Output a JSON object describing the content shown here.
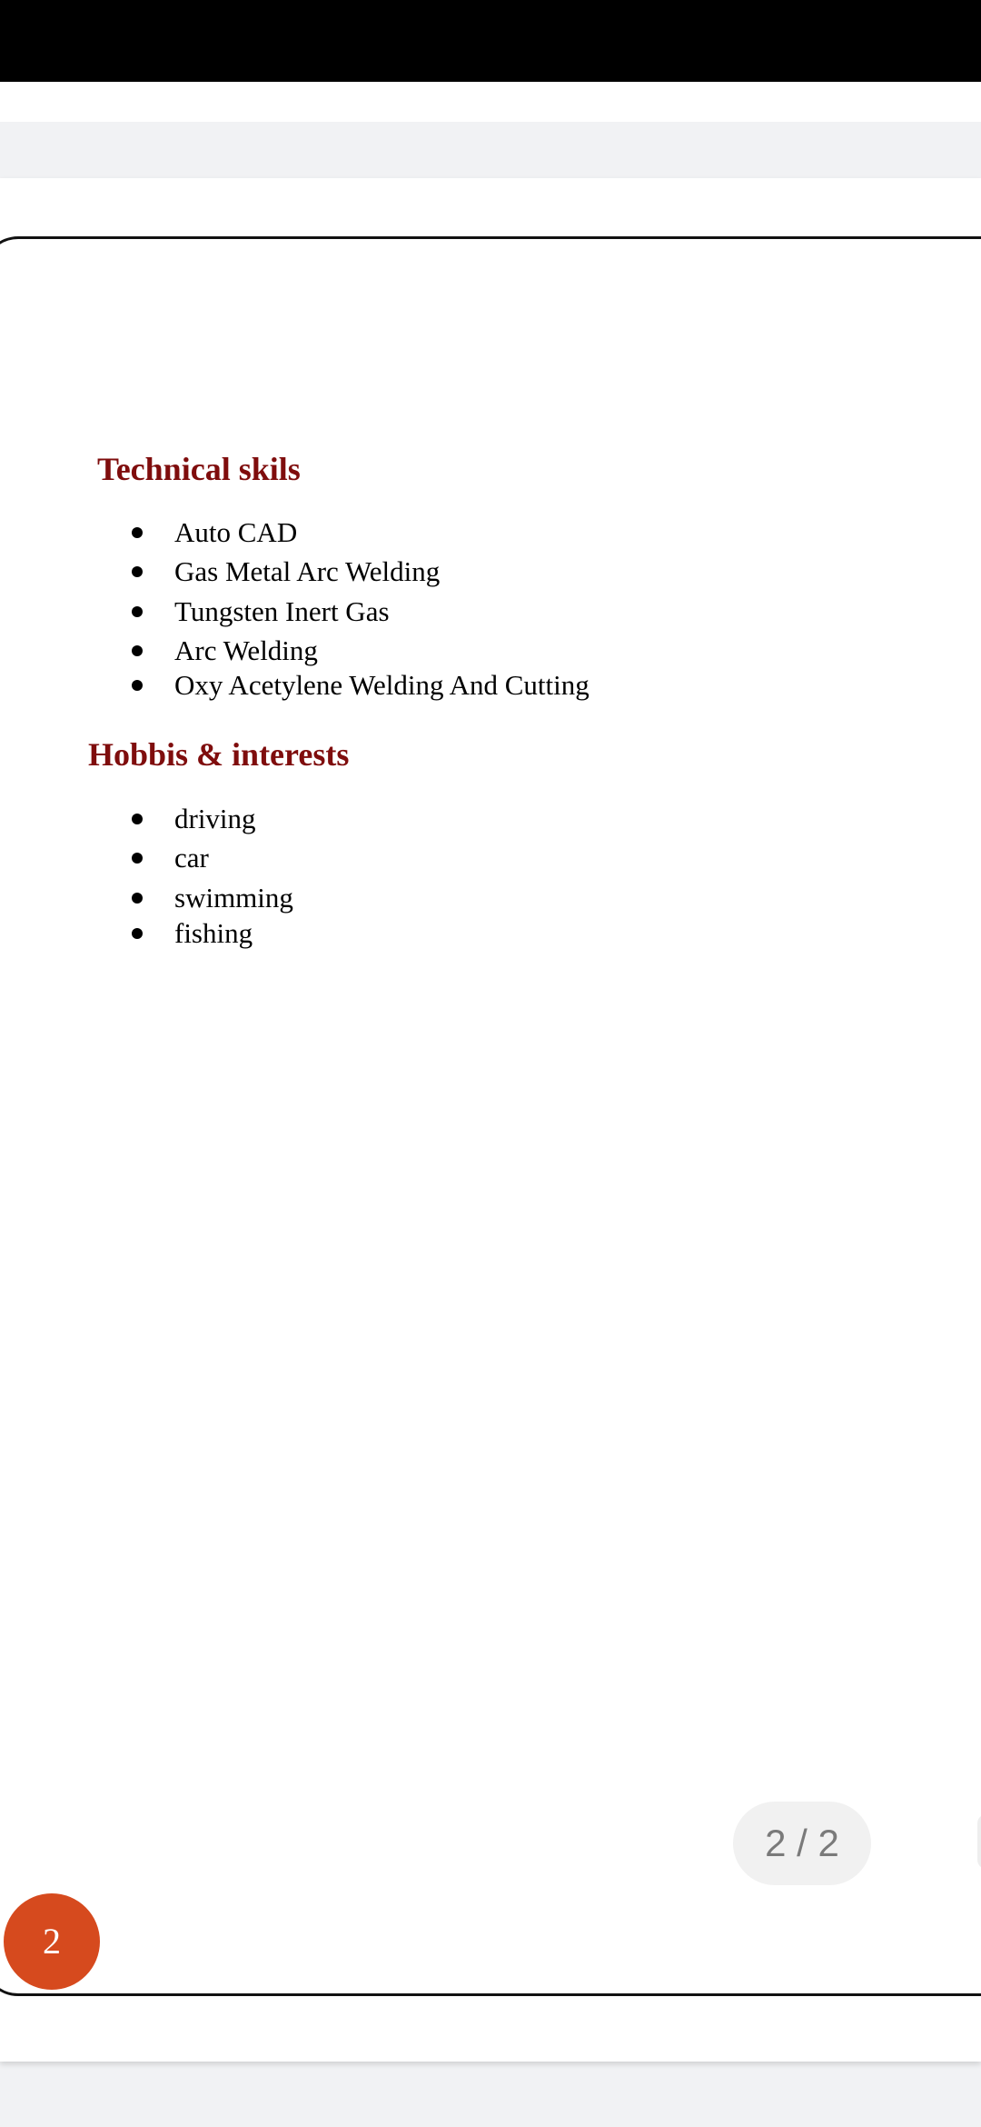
{
  "document": {
    "technical_skills": {
      "heading": "Technical skils",
      "items": [
        "Auto CAD",
        "Gas Metal Arc Welding",
        "Tungsten Inert Gas",
        "Arc Welding",
        "Oxy Acetylene Welding And Cutting"
      ]
    },
    "hobbies": {
      "heading": "Hobbis & interests",
      "items": [
        "driving",
        "car",
        "swimming",
        "fishing"
      ]
    }
  },
  "viewer": {
    "page_counter": "2 / 2",
    "page_badge": "2"
  },
  "colors": {
    "heading": "#7f0d0d",
    "badge": "#d64a1e",
    "status_bar": "#000000"
  }
}
